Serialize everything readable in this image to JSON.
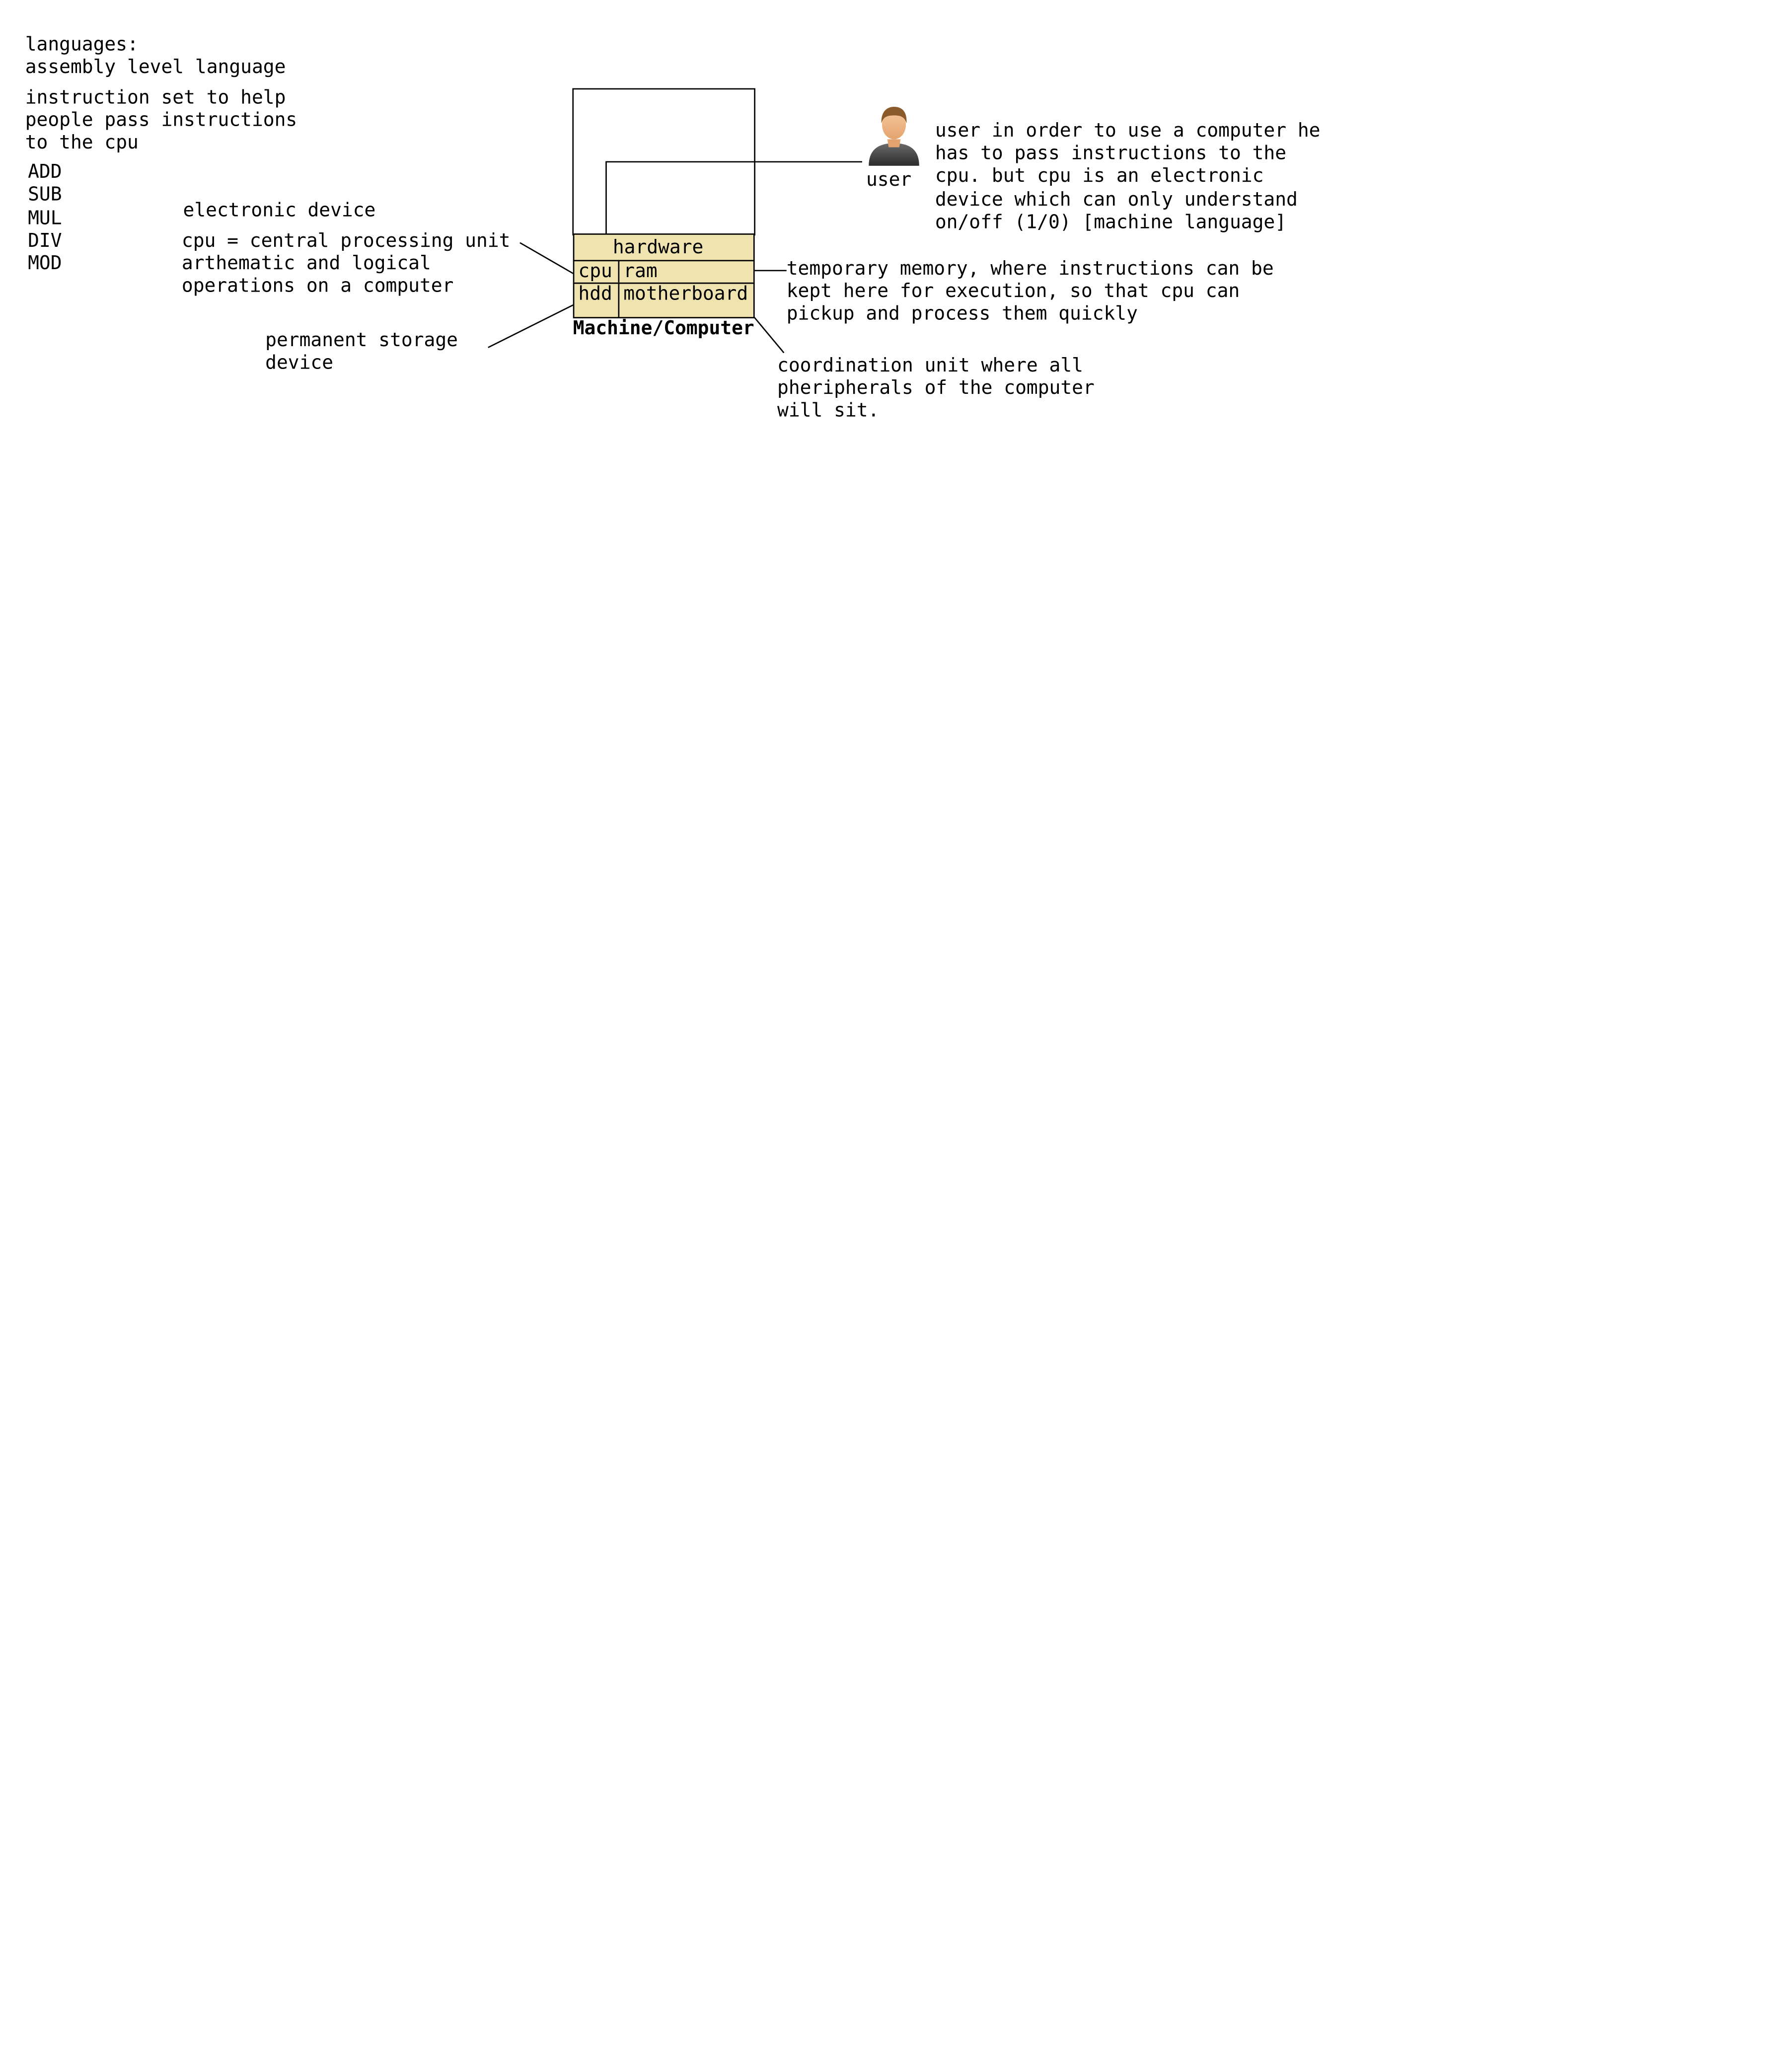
{
  "notes": {
    "languages_line1": "languages:",
    "languages_line2": "assembly level language",
    "instruction_set": "instruction set to help\npeople pass instructions\nto the cpu",
    "opcodes": [
      "ADD",
      "SUB",
      "MUL",
      "DIV",
      "MOD"
    ],
    "electronic_device": "electronic device",
    "cpu_desc": "cpu = central processing unit\narthematic and logical\noperations on a computer",
    "hdd_desc": "permanent storage\ndevice",
    "user_desc": "user in order to use a computer he\nhas to pass instructions to the\ncpu. but cpu is an electronic\ndevice which can only understand\non/off (1/0) [machine language]",
    "ram_desc": "temporary memory, where instructions can be\nkept here for execution, so that cpu can\npickup and process them quickly",
    "motherboard_desc": "coordination unit where all\npheripherals of the computer\nwill sit."
  },
  "machine": {
    "title": "Machine/Computer",
    "hardware_label": "hardware",
    "cpu_label": "cpu",
    "ram_label": "ram",
    "hdd_label": "hdd",
    "motherboard_label": "motherboard",
    "hardware_fill": "#efe4b0"
  },
  "user": {
    "label": "user",
    "icon": "user-avatar-icon"
  }
}
